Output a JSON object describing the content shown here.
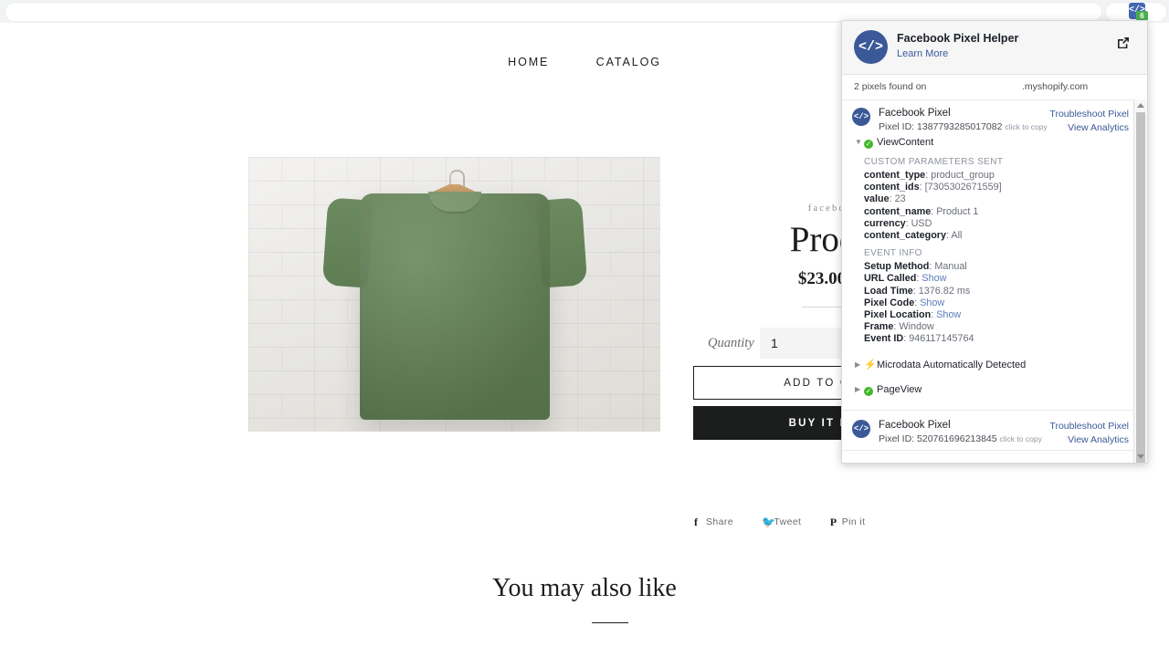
{
  "browser": {
    "extension_icon": "code-brackets-icon",
    "extension_badge": "6"
  },
  "store": {
    "nav": [
      {
        "label": "HOME",
        "name": "nav-home"
      },
      {
        "label": "CATALOG",
        "name": "nav-catalog"
      }
    ],
    "product": {
      "vendor": "facebook-develop",
      "title": "Product 1",
      "price": "$23.00",
      "quantity_label": "Quantity",
      "quantity_value": "1",
      "add_to_cart_label": "ADD TO CART",
      "buy_now_label": "BUY IT NOW",
      "image_alt": "green t-shirt on wooden hanger against white brick wall"
    },
    "share": [
      {
        "label": "Share",
        "glyph": "f",
        "name": "share-facebook"
      },
      {
        "label": "Tweet",
        "glyph": "ᵛ",
        "name": "share-twitter"
      },
      {
        "label": "Pin it",
        "glyph": "P",
        "name": "share-pinterest"
      }
    ],
    "related": {
      "title": "You may also like"
    }
  },
  "pixel_helper": {
    "title": "Facebook Pixel Helper",
    "learn_more": "Learn More",
    "open_icon": "external-link-icon",
    "found_text": "2 pixels found on",
    "domain": ".myshopify.com",
    "pixels": [
      {
        "name": "Facebook Pixel",
        "id_label": "Pixel ID: 1387793285017082",
        "copy_hint": "click to copy",
        "troubleshoot": "Troubleshoot Pixel",
        "analytics": "View Analytics",
        "events": [
          {
            "name": "ViewContent",
            "expanded": true,
            "status": "ok",
            "custom_params_label": "CUSTOM PARAMETERS SENT",
            "custom_params": [
              {
                "key": "content_type",
                "value": "product_group"
              },
              {
                "key": "content_ids",
                "value": "[7305302671559]"
              },
              {
                "key": "value",
                "value": "23"
              },
              {
                "key": "content_name",
                "value": "Product 1"
              },
              {
                "key": "currency",
                "value": "USD"
              },
              {
                "key": "content_category",
                "value": "All"
              }
            ],
            "event_info_label": "EVENT INFO",
            "event_info": [
              {
                "key": "Setup Method",
                "value": "Manual"
              },
              {
                "key": "URL Called",
                "value": "Show",
                "link": true
              },
              {
                "key": "Load Time",
                "value": "1376.82 ms"
              },
              {
                "key": "Pixel Code",
                "value": "Show",
                "link": true
              },
              {
                "key": "Pixel Location",
                "value": "Show",
                "link": true
              },
              {
                "key": "Frame",
                "value": "Window"
              },
              {
                "key": "Event ID",
                "value": "946117145764"
              }
            ]
          },
          {
            "name": "Microdata Automatically Detected",
            "expanded": false,
            "status": "bolt"
          },
          {
            "name": "PageView",
            "expanded": false,
            "status": "ok"
          }
        ]
      },
      {
        "name": "Facebook Pixel",
        "id_label": "Pixel ID: 520761696213845",
        "copy_hint": "click to copy",
        "troubleshoot": "Troubleshoot Pixel",
        "analytics": "View Analytics",
        "events": []
      }
    ]
  },
  "colors": {
    "brand_blue": "#3b5998",
    "link_blue": "#3b5998",
    "ok_green": "#42b72a",
    "badge_green": "#4caf50",
    "dark": "#1c1d1d"
  }
}
